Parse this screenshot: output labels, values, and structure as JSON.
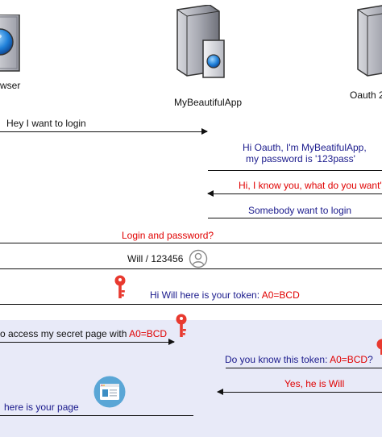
{
  "actors": {
    "browser": "wser",
    "app": "MyBeautifulApp",
    "oauth": "Oauth 2"
  },
  "messages": {
    "m1": "Hey I want to login",
    "m2_line1": "Hi Oauth, I'm MyBeatifulApp,",
    "m2_line2": "my password is '123pass'",
    "m3": "Hi, I know you, what do you want'",
    "m4": "Somebody want to login",
    "m5": "Login and password?",
    "m6": "Will / 123456",
    "m7_prefix": "Hi Will here is your token: ",
    "m7_token": "A0=BCD",
    "m8_prefix": "o access my secret page with ",
    "m8_token": "A0=BCD",
    "m9_prefix": "Do you know this token: ",
    "m9_token": "A0=BCD",
    "m9_suffix": "?",
    "m10": "Yes, he is Will",
    "m11": "here is your page"
  },
  "colors": {
    "text_black": "#111111",
    "text_navy": "#1a1a8c",
    "text_red": "#e00000",
    "band": "#e8eaf8",
    "key": "#e8392f"
  },
  "icons": [
    "browser-icon",
    "server-icon",
    "key-icon",
    "user-icon",
    "webpage-icon"
  ]
}
